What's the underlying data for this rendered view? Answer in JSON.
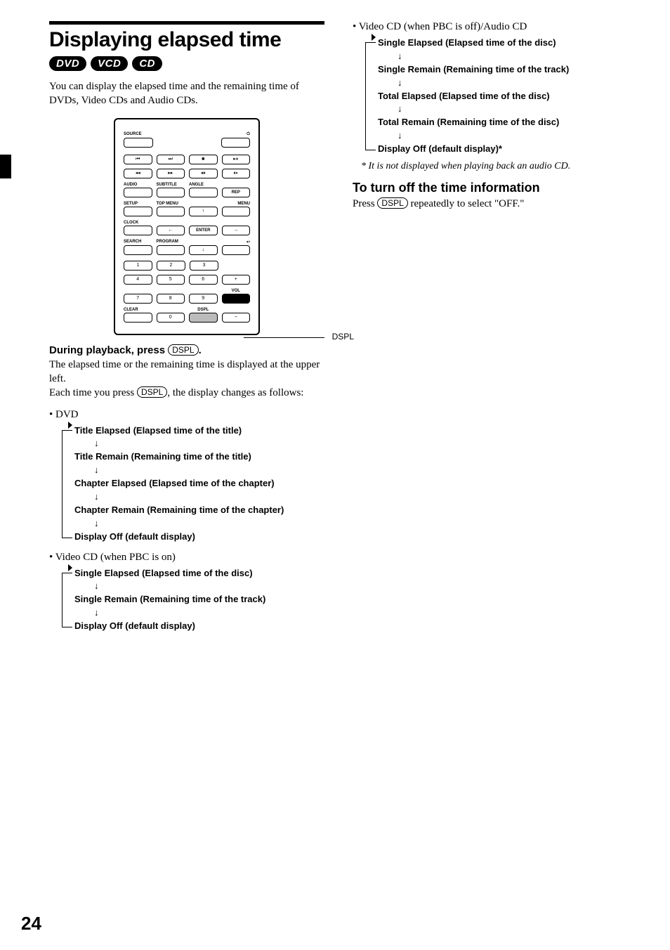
{
  "title": "Displaying elapsed time",
  "disc_types": [
    "DVD",
    "VCD",
    "CD"
  ],
  "intro": "You can display the elapsed time and the remaining time of DVDs, Video CDs and Audio CDs.",
  "remote": {
    "labels": {
      "source": "SOURCE",
      "power": "⏻",
      "audio": "AUDIO",
      "subtitle": "SUBTITLE",
      "angle": "ANGLE",
      "rep": "REP",
      "setup": "SETUP",
      "topmenu": "TOP MENU",
      "menu": "MENU",
      "clock": "CLOCK",
      "enter": "ENTER",
      "search": "SEARCH",
      "program": "PROGRAM",
      "clear": "CLEAR",
      "dspl": "DSPL",
      "vol": "VOL"
    },
    "callout": "DSPL"
  },
  "step_head": "During playback, press ",
  "dspl_label": "DSPL",
  "step_tail": ".",
  "step_body1": "The elapsed time or the remaining time is displayed at the upper left.",
  "step_body2a": "Each time you press ",
  "step_body2b": ", the display changes as follows:",
  "dvd_bullet": "• DVD",
  "dvd_cycle": [
    "Title Elapsed (Elapsed time of the title)",
    "Title Remain (Remaining time of the title)",
    "Chapter Elapsed (Elapsed time of the chapter)",
    "Chapter Remain (Remaining time of the chapter)",
    "Display Off (default display)"
  ],
  "vcd_pbc_on_bullet": "• Video CD (when PBC is on)",
  "vcd_pbc_on_cycle": [
    "Single Elapsed (Elapsed time of the disc)",
    "Single Remain (Remaining time of the track)",
    "Display Off (default display)"
  ],
  "vcd_pbc_off_bullet": "• Video CD (when PBC is off)/Audio CD",
  "vcd_pbc_off_cycle": [
    "Single Elapsed (Elapsed time of the disc)",
    "Single Remain (Remaining time of the track)",
    "Total Elapsed (Elapsed time of the disc)",
    "Total Remain (Remaining time of the disc)",
    "Display Off (default display)*"
  ],
  "footnote": "* It is not displayed when playing back an audio CD.",
  "turn_off_heading": "To turn off the time information",
  "turn_off_a": "Press ",
  "turn_off_b": " repeatedly to select \"OFF.\"",
  "page_number": "24"
}
